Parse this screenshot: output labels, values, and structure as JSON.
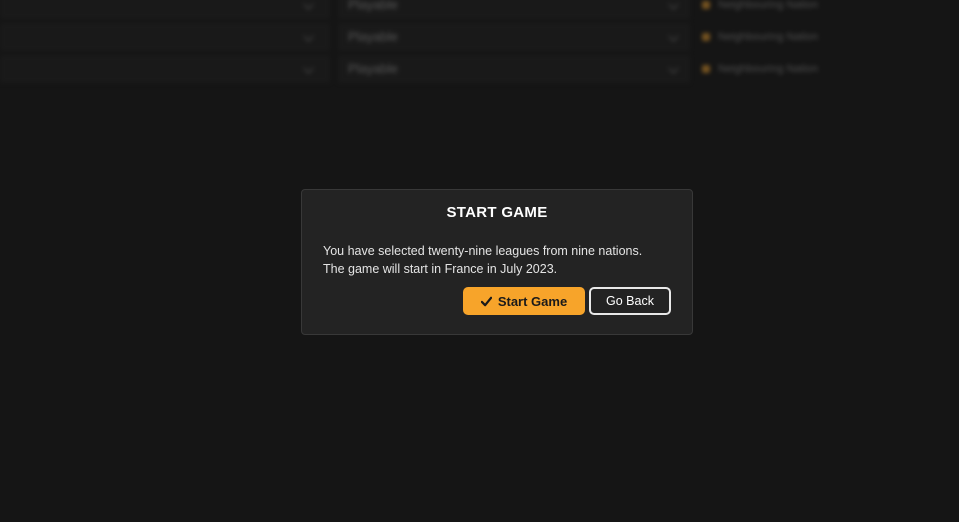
{
  "background": {
    "rows": [
      {
        "value": "Playable",
        "tag": "Neighbouring Nation"
      },
      {
        "value": "Playable",
        "tag": "Neighbouring Nation"
      },
      {
        "value": "Playable",
        "tag": "Neighbouring Nation"
      }
    ]
  },
  "dialog": {
    "title": "START GAME",
    "line1": "You have selected twenty-nine leagues from nine nations.",
    "line2": "The game will start in France in July 2023.",
    "start_label": "Start Game",
    "back_label": "Go Back",
    "start_icon": "check-icon"
  },
  "colors": {
    "accent": "#f7a42a",
    "dialog_bg": "#232323",
    "page_bg": "#151515"
  }
}
